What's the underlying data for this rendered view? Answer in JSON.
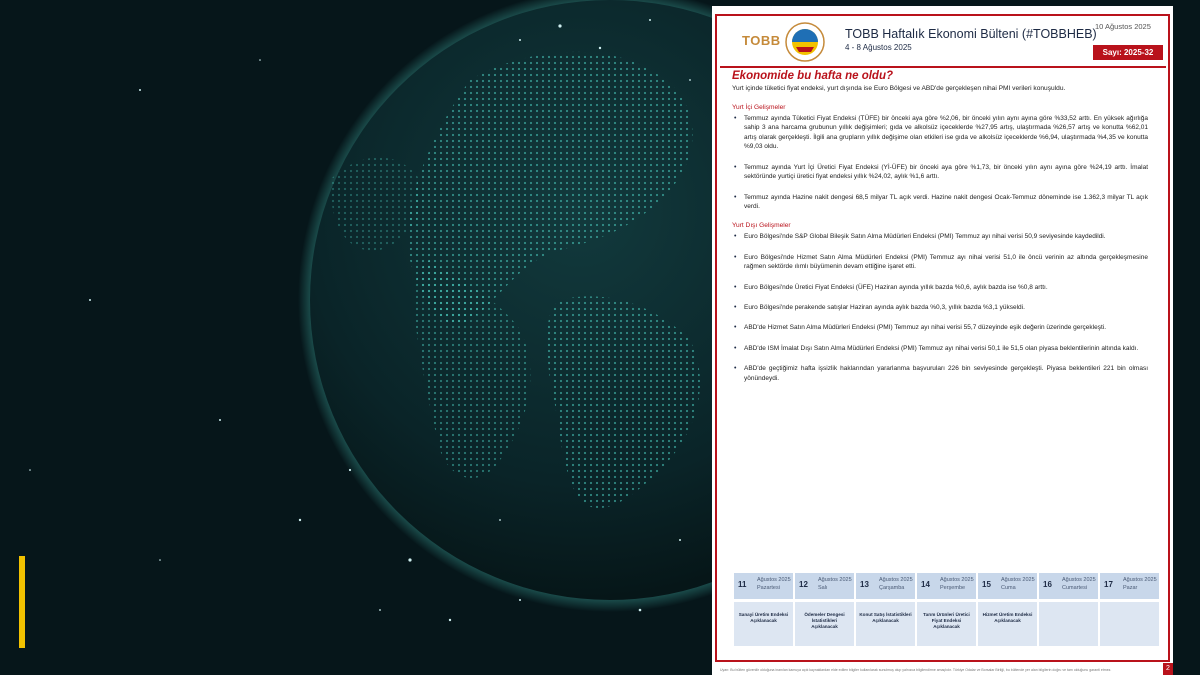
{
  "colors": {
    "accent_red": "#b9121b",
    "navy": "#1d2a44",
    "highlight_yellow": "#f2c200",
    "globe_teal": "#4fd6c8"
  },
  "bulletin": {
    "logo_text": "TOBB",
    "title": "TOBB Haftalık Ekonomi Bülteni (#TOBBHEB)",
    "week": "4 - 8 Ağustos 2025",
    "date": "10 Ağustos 2025",
    "issue": "Sayı: 2025-32",
    "heading": "Ekonomide bu hafta ne oldu?",
    "intro": "Yurt içinde tüketici fiyat endeksi, yurt dışında ise Euro Bölgesi ve ABD'de gerçekleşen nihai PMI verileri konuşuldu.",
    "domestic_heading": "Yurt İçi Gelişmeler",
    "domestic": [
      "Temmuz ayında Tüketici Fiyat Endeksi (TÜFE) bir önceki aya göre %2,06, bir önceki yılın aynı ayına göre %33,52 arttı. En yüksek ağırlığa sahip 3 ana harcama grubunun yıllık değişimleri; gıda ve alkolsüz içeceklerde %27,95 artış, ulaştırmada %26,57 artış ve konutta %62,01 artış olarak gerçekleşti. İlgili ana grupların yıllık değişime olan etkileri ise gıda ve alkolsüz içeceklerde %6,94, ulaştırmada %4,35 ve konutta %9,03 oldu.",
      "Temmuz ayında Yurt İçi Üretici Fiyat Endeksi (Yİ-ÜFE) bir önceki aya göre %1,73, bir önceki yılın aynı ayına göre %24,19 arttı. İmalat sektöründe yurtiçi üretici fiyat endeksi yıllık %24,02, aylık %1,6 arttı.",
      "Temmuz ayında Hazine nakit dengesi 68,5 milyar TL açık verdi. Hazine nakit dengesi Ocak-Temmuz döneminde ise 1.362,3 milyar TL açık verdi."
    ],
    "foreign_heading": "Yurt Dışı Gelişmeler",
    "foreign": [
      "Euro Bölgesi'nde S&P Global Bileşik Satın Alma Müdürleri Endeksi (PMI) Temmuz ayı nihai verisi 50,9 seviyesinde kaydedildi.",
      "Euro Bölgesi'nde Hizmet Satın Alma Müdürleri Endeksi (PMI) Temmuz ayı nihai verisi 51,0 ile öncü verinin az altında gerçekleşmesine rağmen sektörde ılımlı büyümenin devam ettiğine işaret etti.",
      "Euro Bölgesi'nde Üretici Fiyat Endeksi (ÜFE) Haziran ayında yıllık bazda %0,6, aylık bazda ise %0,8 arttı.",
      "Euro Bölgesi'nde perakende satışlar Haziran ayında aylık bazda %0,3, yıllık bazda %3,1 yükseldi.",
      "ABD'de Hizmet Satın Alma Müdürleri Endeksi (PMI) Temmuz ayı nihai verisi 55,7 düzeyinde eşik değerin üzerinde gerçekleşti.",
      "ABD'de ISM İmalat Dışı Satın Alma Müdürleri Endeksi (PMI) Temmuz ayı nihai verisi 50,1 ile 51,5 olan piyasa beklentilerinin altında kaldı.",
      "ABD'de geçtiğimiz hafta işsizlik haklarından yararlanma başvuruları 226 bin seviyesinde gerçekleşti. Piyasa beklentileri 221 bin olması yönündeydi."
    ],
    "calendar": [
      {
        "num": "11",
        "month": "Ağustos 2025",
        "day": "Pazartesi",
        "event": "Sanayi Üretim Endeksi Açıklanacak"
      },
      {
        "num": "12",
        "month": "Ağustos 2025",
        "day": "Salı",
        "event": "Ödemeler Dengesi İstatistikleri Açıklanacak"
      },
      {
        "num": "13",
        "month": "Ağustos 2025",
        "day": "Çarşamba",
        "event": "Konut Satış İstatistikleri Açıklanacak"
      },
      {
        "num": "14",
        "month": "Ağustos 2025",
        "day": "Perşembe",
        "event": "Tarım Ürünleri Üretici Fiyat Endeksi Açıklanacak"
      },
      {
        "num": "15",
        "month": "Ağustos 2025",
        "day": "Cuma",
        "event": "Hizmet Üretim Endeksi Açıklanacak"
      },
      {
        "num": "16",
        "month": "Ağustos 2025",
        "day": "Cumartesi",
        "event": ""
      },
      {
        "num": "17",
        "month": "Ağustos 2025",
        "day": "Pazar",
        "event": ""
      }
    ],
    "footer": "Uyarı: Bu bülten güvenilir olduğuna inanılan kamuya açık kaynaklardan elde edilen bilgiler kullanılarak sunulmuş olup yalnızca bilgilendirme amaçlıdır. Türkiye Odalar ve Borsalar Birliği, bu bültende yer alan bilgilerin doğru ve tam olduğunu garanti etmez.",
    "page": "2"
  }
}
